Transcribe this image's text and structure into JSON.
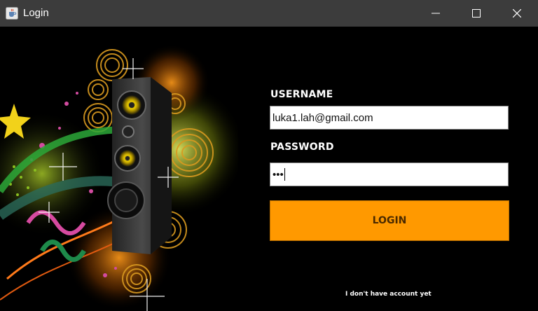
{
  "window": {
    "title": "Login",
    "icon": "java-cup-icon"
  },
  "form": {
    "username_label": "USERNAME",
    "username_value": "luka1.lah@gmail.com",
    "password_label": "PASSWORD",
    "password_value": "•••",
    "login_label": "LOGIN",
    "signup_link": "I don't have account yet"
  },
  "colors": {
    "titlebar": "#3c3c3c",
    "background": "#000000",
    "accent": "#ff9900"
  },
  "artwork": {
    "subject": "speaker-artwork"
  }
}
